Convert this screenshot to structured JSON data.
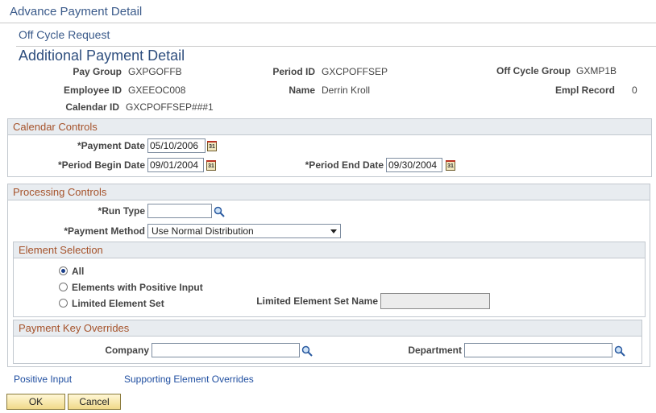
{
  "page_title": "Advance Payment Detail",
  "subtitle": "Off Cycle Request",
  "main_title": "Additional Payment Detail",
  "header": {
    "pay_group_label": "Pay Group",
    "pay_group_value": "GXPGOFFB",
    "period_id_label": "Period ID",
    "period_id_value": "GXCPOFFSEP",
    "off_cycle_group_label": "Off Cycle Group",
    "off_cycle_group_value": "GXMP1B",
    "employee_id_label": "Employee ID",
    "employee_id_value": "GXEEOC008",
    "name_label": "Name",
    "name_value": "Derrin Kroll",
    "empl_record_label": "Empl Record",
    "empl_record_value": "0",
    "calendar_id_label": "Calendar ID",
    "calendar_id_value": "GXCPOFFSEP###1"
  },
  "calendar_controls": {
    "title": "Calendar Controls",
    "payment_date_label": "*Payment Date",
    "payment_date_value": "05/10/2006",
    "period_begin_label": "*Period Begin Date",
    "period_begin_value": "09/01/2004",
    "period_end_label": "*Period End Date",
    "period_end_value": "09/30/2004"
  },
  "processing_controls": {
    "title": "Processing Controls",
    "run_type_label": "*Run Type",
    "run_type_value": "",
    "payment_method_label": "*Payment Method",
    "payment_method_value": "Use Normal Distribution"
  },
  "element_selection": {
    "title": "Element Selection",
    "options": [
      "All",
      "Elements with Positive Input",
      "Limited Element Set"
    ],
    "selected_index": 0,
    "limited_set_label": "Limited Element Set Name",
    "limited_set_value": ""
  },
  "payment_key_overrides": {
    "title": "Payment Key Overrides",
    "company_label": "Company",
    "company_value": "",
    "department_label": "Department",
    "department_value": ""
  },
  "links": {
    "positive_input": "Positive Input",
    "supporting_overrides": "Supporting Element Overrides"
  },
  "buttons": {
    "ok": "OK",
    "cancel": "Cancel"
  },
  "calendar_icon_text": "31",
  "icons": {
    "calendar": "calendar-icon",
    "lookup": "magnifier-icon",
    "dropdown": "chevron-down-icon"
  },
  "colors": {
    "title_blue": "#3a5a8a",
    "group_header_text": "#a5522a",
    "link_blue": "#1f4ea0",
    "button_gold": "#f0d98a"
  }
}
